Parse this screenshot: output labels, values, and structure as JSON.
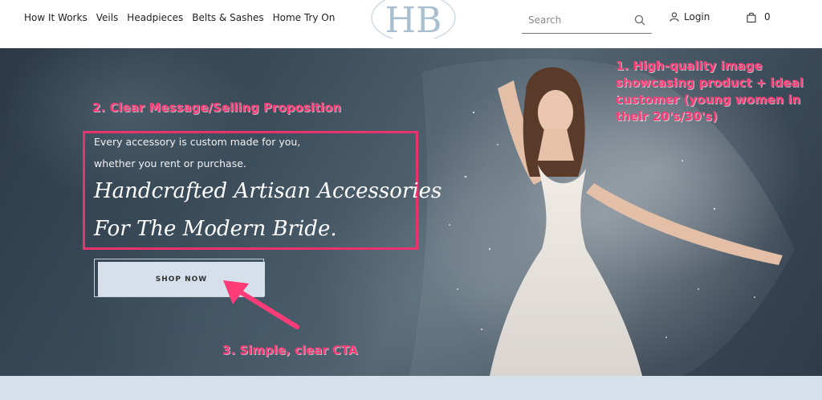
{
  "nav": {
    "items": [
      {
        "label": "How It Works"
      },
      {
        "label": "Veils"
      },
      {
        "label": "Headpieces"
      },
      {
        "label": "Belts & Sashes"
      },
      {
        "label": "Home Try On"
      }
    ]
  },
  "logo": {
    "text": "HB"
  },
  "search": {
    "placeholder": "Search"
  },
  "account": {
    "login_label": "Login"
  },
  "cart": {
    "count": "0"
  },
  "hero": {
    "subtext_line1": "Every accessory is custom made for you,",
    "subtext_line2": "whether you rent or purchase.",
    "heading_line1": "Handcrafted Artisan Accessories",
    "heading_line2": "For The Modern Bride.",
    "cta_label": "SHOP NOW"
  },
  "annotations": {
    "note1": "1. High-quality image showcasing product + ideal customer (young women in their 20's/30's)",
    "note2": "2. Clear Message/Selling Proposition",
    "note3": "3. Simple, clear CTA"
  },
  "colors": {
    "accent": "#e8336e",
    "annotation": "#ff3c78",
    "cta_background": "#d5e0ea",
    "logo": "#a9bfcf"
  },
  "icons": [
    "search-icon",
    "user-icon",
    "shopping-bag-icon"
  ]
}
